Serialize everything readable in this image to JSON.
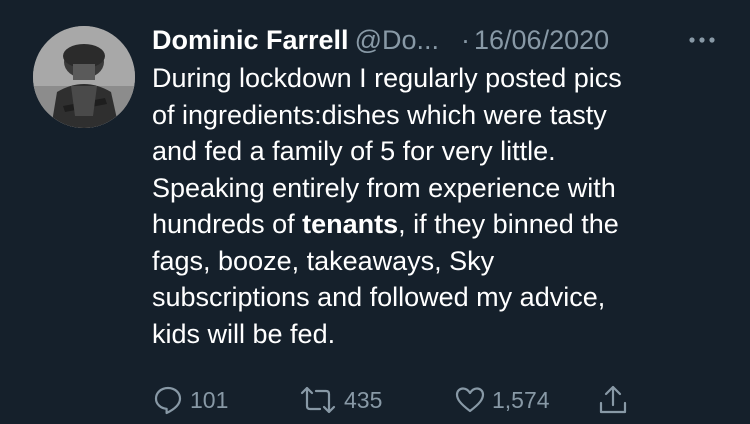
{
  "tweet": {
    "author": {
      "display_name": "Dominic Farrell",
      "handle": "@Do..."
    },
    "separator": "·",
    "date": "16/06/2020",
    "body_lines": {
      "l1": "During lockdown I regularly posted pics",
      "l2": "of ingredients:dishes which were tasty",
      "l3": "and fed a family of 5 for very little.",
      "l4": "Speaking entirely from experience with",
      "l5a": "hundreds of ",
      "l5b": "tenants",
      "l5c": ", if they binned the",
      "l6": "fags, booze, takeaways, Sky",
      "l7": "subscriptions and followed my advice,",
      "l8": "kids will be fed."
    },
    "stats": {
      "replies": "101",
      "retweets": "435",
      "likes": "1,574"
    }
  },
  "icons": {
    "avatar": "soldier-photo",
    "more": "more-horizontal-icon",
    "reply": "reply-icon",
    "retweet": "retweet-icon",
    "like": "heart-icon",
    "share": "share-icon"
  },
  "colors": {
    "background": "#15202b",
    "text": "#ffffff",
    "secondary": "#8899a6"
  }
}
